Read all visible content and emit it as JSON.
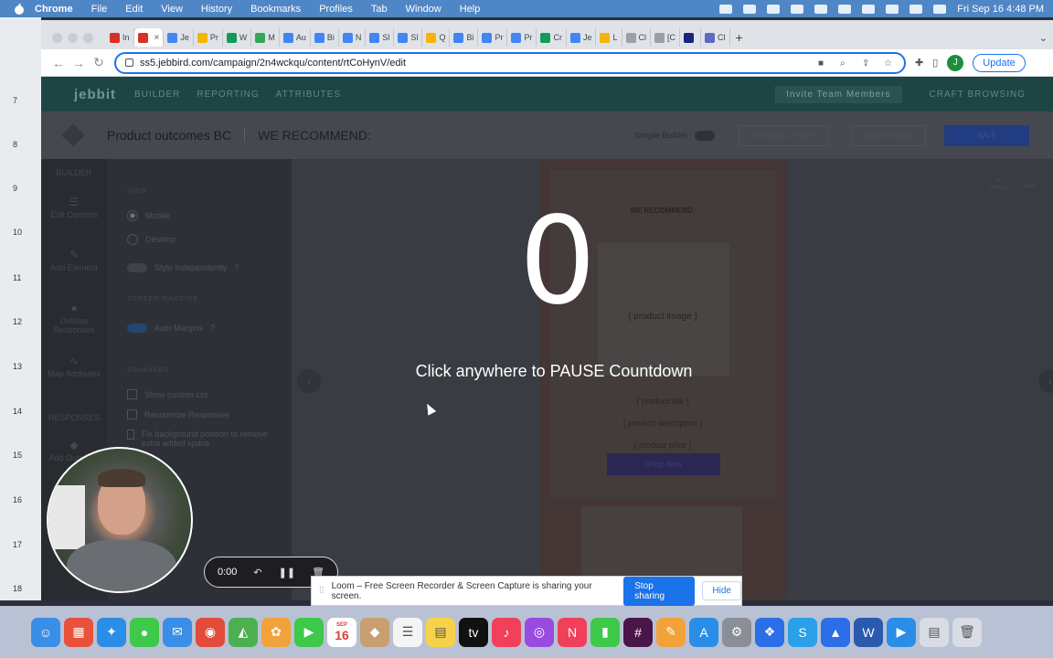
{
  "menubar": {
    "app": "Chrome",
    "items": [
      "File",
      "Edit",
      "View",
      "History",
      "Bookmarks",
      "Profiles",
      "Tab",
      "Window",
      "Help"
    ],
    "datetime": "Fri Sep 16  4:48 PM"
  },
  "ruler": [
    "7",
    "8",
    "9",
    "10",
    "11",
    "12",
    "13",
    "14",
    "15",
    "16",
    "17",
    "18"
  ],
  "browser": {
    "tabs": [
      {
        "label": "In",
        "color": "#d93025"
      },
      {
        "label": "",
        "color": "#d93025",
        "active": true
      },
      {
        "label": "Je",
        "color": "#4285f4"
      },
      {
        "label": "Pr",
        "color": "#f4b400"
      },
      {
        "label": "W",
        "color": "#0f9d58"
      },
      {
        "label": "M",
        "color": "#34a853"
      },
      {
        "label": "Au",
        "color": "#4285f4"
      },
      {
        "label": "Bi",
        "color": "#4285f4"
      },
      {
        "label": "N",
        "color": "#4285f4"
      },
      {
        "label": "Sl",
        "color": "#4285f4"
      },
      {
        "label": "Sl",
        "color": "#4285f4"
      },
      {
        "label": "Q",
        "color": "#f4b400"
      },
      {
        "label": "Bi",
        "color": "#4285f4"
      },
      {
        "label": "Pr",
        "color": "#4285f4"
      },
      {
        "label": "Pr",
        "color": "#4285f4"
      },
      {
        "label": "Cr",
        "color": "#0f9d58"
      },
      {
        "label": "Je",
        "color": "#4285f4"
      },
      {
        "label": "L",
        "color": "#f4b400"
      },
      {
        "label": "Cl",
        "color": "#9aa0a6"
      },
      {
        "label": "[C",
        "color": "#9aa0a6"
      },
      {
        "label": "",
        "color": "#1a237e"
      },
      {
        "label": "Cl",
        "color": "#5c6bc0"
      }
    ],
    "url": "ss5.jebbird.com/campaign/2n4wckqu/content/rtCoHynV/edit",
    "profile_initial": "J",
    "update_label": "Update"
  },
  "app": {
    "logo": "jebbit",
    "nav": [
      "BUILDER",
      "REPORTING",
      "ATTRIBUTES"
    ],
    "nav_button": "Invite Team Members",
    "nav_right": "CRAFT BROWSING",
    "campaign_title": "Product outcomes BC",
    "screen_title": "WE RECOMMEND:",
    "simple_builder": "Simple Builder",
    "change_layout": "CHANGE LAYOUT",
    "preview": {
      "heading": "WE RECOMMEND:",
      "image_placeholder": "{ product image }",
      "title_placeholder": "{ product title }",
      "description_placeholder": "{ product description }",
      "price_placeholder": "{ product price }",
      "shop_button": "Shop Now"
    },
    "save": "SAVE",
    "sidebar": [
      {
        "icon": "builder-icon",
        "label": "BUILDER"
      },
      {
        "icon": "edit-controls-icon",
        "label": "Edit Controls"
      },
      {
        "icon": "add-element-icon",
        "label": "Add Element"
      },
      {
        "icon": "overlay-responses-icon",
        "label": "Overlay Responses"
      },
      {
        "icon": "map-attributes-icon",
        "label": "Map Attributes"
      },
      {
        "icon": "responses-icon",
        "label": "RESPONSES"
      },
      {
        "icon": "add-outcome-icon",
        "label": "Add Outcome"
      }
    ],
    "panel": {
      "view_label": "VIEW",
      "mobile": "Mobile",
      "desktop": "Desktop",
      "style_independently": "Style Independently",
      "screen_margins": "SCREEN MARGINS",
      "auto_margins": "Auto Margins",
      "advanced": "ADVANCED",
      "custom_css": "Show custom css",
      "randomize": "Randomize Responses",
      "fix_bg": "Fix background position to remove extra added space"
    },
    "tools": [
      "Design",
      "Add"
    ]
  },
  "overlay": {
    "countdown": "0",
    "message": "Click anywhere to PAUSE Countdown"
  },
  "loom": {
    "timer": "0:00",
    "share_message": "Loom – Free Screen Recorder & Screen Capture is sharing your screen.",
    "stop_label": "Stop sharing",
    "hide_label": "Hide"
  },
  "dock": {
    "calendar_month": "SEP",
    "calendar_day": "16",
    "apps": [
      {
        "icon": "finder-icon",
        "color": "#3a8ee6",
        "glyph": "☺"
      },
      {
        "icon": "launchpad-icon",
        "color": "#e8523a",
        "glyph": "▦"
      },
      {
        "icon": "safari-icon",
        "color": "#2a8ee8",
        "glyph": "✦"
      },
      {
        "icon": "messages-icon",
        "color": "#3ec94a",
        "glyph": "●"
      },
      {
        "icon": "mail-icon",
        "color": "#3a8ee6",
        "glyph": "✉"
      },
      {
        "icon": "chrome-icon",
        "color": "#e24a3a",
        "glyph": "◉"
      },
      {
        "icon": "maps-icon",
        "color": "#4cb050",
        "glyph": "◭"
      },
      {
        "icon": "photos-icon",
        "color": "#f2a23a",
        "glyph": "✿"
      },
      {
        "icon": "facetime-icon",
        "color": "#3ec94a",
        "glyph": "▶"
      },
      {
        "icon": "calendar-icon",
        "color": "#ffffff",
        "glyph": ""
      },
      {
        "icon": "contacts-icon",
        "color": "#c8a070",
        "glyph": "◆"
      },
      {
        "icon": "reminders-icon",
        "color": "#f4f4f4",
        "glyph": "☰"
      },
      {
        "icon": "notes-icon",
        "color": "#f6d24a",
        "glyph": "▤"
      },
      {
        "icon": "tv-icon",
        "color": "#111111",
        "glyph": "tv"
      },
      {
        "icon": "music-icon",
        "color": "#f0405a",
        "glyph": "♪"
      },
      {
        "icon": "podcasts-icon",
        "color": "#9a4ae0",
        "glyph": "◎"
      },
      {
        "icon": "news-icon",
        "color": "#f0405a",
        "glyph": "N"
      },
      {
        "icon": "numbers-icon",
        "color": "#3ec94a",
        "glyph": "▮"
      },
      {
        "icon": "slack-icon",
        "color": "#4a154b",
        "glyph": "#"
      },
      {
        "icon": "pages-icon",
        "color": "#f2a23a",
        "glyph": "✎"
      },
      {
        "icon": "app-store-icon",
        "color": "#2a8ee8",
        "glyph": "A"
      },
      {
        "icon": "system-preferences-icon",
        "color": "#8a8e96",
        "glyph": "⚙"
      },
      {
        "icon": "dropbox-icon",
        "color": "#2a6ee8",
        "glyph": "❖"
      },
      {
        "icon": "skype-icon",
        "color": "#2aa0e8",
        "glyph": "S"
      },
      {
        "icon": "keynote-icon",
        "color": "#2a6ee8",
        "glyph": "▲"
      },
      {
        "icon": "word-icon",
        "color": "#2a5aae",
        "glyph": "W"
      },
      {
        "icon": "zoom-icon",
        "color": "#2a8ee8",
        "glyph": "▶"
      },
      {
        "icon": "downloads-icon",
        "color": "#d8dce4",
        "glyph": "▤"
      },
      {
        "icon": "trash-icon",
        "color": "#d8dce4",
        "glyph": "🗑"
      }
    ]
  }
}
